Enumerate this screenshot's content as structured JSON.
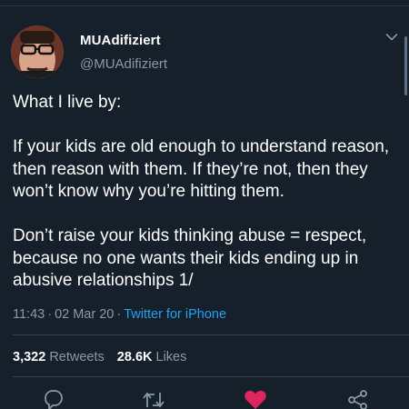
{
  "tweet": {
    "display_name": "MUAdifiziert",
    "handle": "@MUAdifiziert",
    "paragraphs": [
      "What I live by:",
      "If your kids are old enough to understand reason, then reason with them. If they’re not, then they won’t know why you’re hitting them.",
      "Don’t raise your kids thinking abuse = respect, because no one wants their kids ending up in abusive relationships 1/"
    ],
    "time": "11:43",
    "separator": "·",
    "date": "02 Mar 20",
    "source": "Twitter for iPhone"
  },
  "stats": {
    "retweets_count": "3,322",
    "retweets_label": "Retweets",
    "likes_count": "28.6K",
    "likes_label": "Likes"
  },
  "icons": {
    "reply": "reply-icon",
    "retweet": "retweet-icon",
    "like": "heart-icon",
    "share": "share-icon",
    "menu": "chevron-down-icon"
  },
  "colors": {
    "background": "#15202b",
    "text": "#ffffff",
    "muted": "#8899a6",
    "link": "#1da1f2",
    "like": "#e0245e"
  }
}
